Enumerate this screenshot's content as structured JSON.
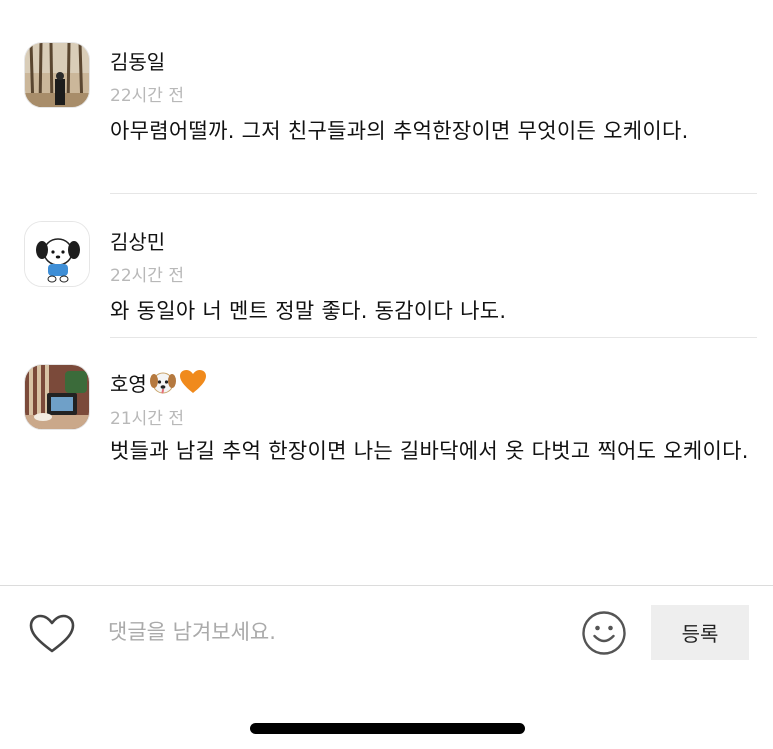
{
  "comments": [
    {
      "author": "김동일",
      "time": "22시간 전",
      "text": "아무렴어떨까. 그저 친구들과의 추억한장이면 무엇이든 오케이다."
    },
    {
      "author": "김상민",
      "time": "22시간 전",
      "text": "와 동일아 너 멘트 정말 좋다. 동감이다 나도."
    },
    {
      "author": "호영",
      "author_emojis": [
        "dog-face-emoji",
        "orange-heart-emoji"
      ],
      "time": "21시간 전",
      "text": "벗들과 남길 추억 한장이면 나는 길바닥에서 옷 다벗고 찍어도 오케이다."
    }
  ],
  "composer": {
    "placeholder": "댓글을 남겨보세요.",
    "submit_label": "등록",
    "like_icon": "heart-outline-icon",
    "emoji_icon": "smiley-icon"
  },
  "colors": {
    "text": "#111111",
    "time": "#b8b8b8",
    "divider": "#e6e6e6",
    "submit_bg": "#eeeeee"
  }
}
